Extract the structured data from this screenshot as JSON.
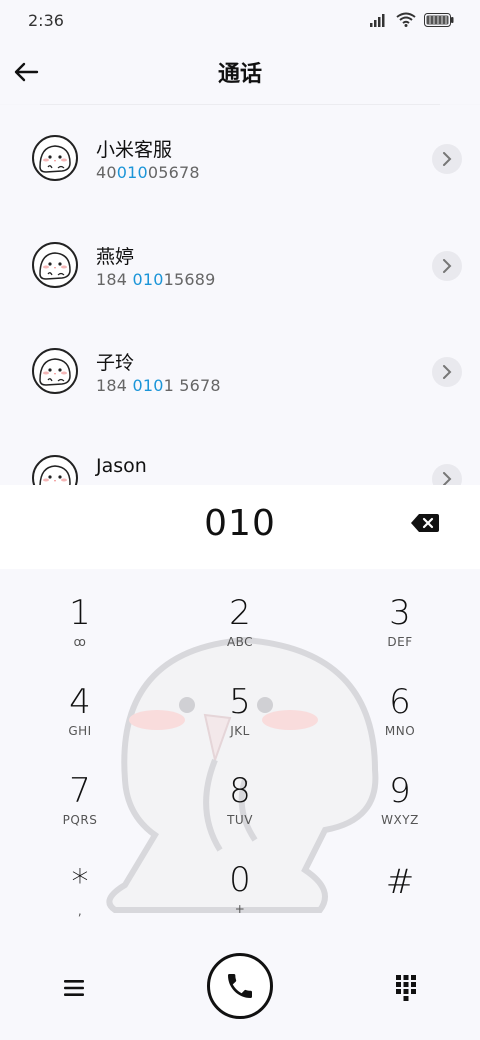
{
  "status_bar": {
    "time": "2:36"
  },
  "header": {
    "title": "通话"
  },
  "contacts": [
    {
      "name": "小米客服",
      "number_parts": [
        "40",
        "010",
        "05678"
      ]
    },
    {
      "name": "燕婷",
      "number_parts": [
        "184 ",
        "010",
        "15689"
      ]
    },
    {
      "name": "子玲",
      "number_parts": [
        "184 ",
        "010",
        "1 5678"
      ]
    },
    {
      "name": "Jason",
      "number_parts": [
        "",
        "",
        ""
      ]
    }
  ],
  "dialer": {
    "typed_number": "010",
    "keys": [
      {
        "digit": "1",
        "letters": "ꝏ"
      },
      {
        "digit": "2",
        "letters": "ABC"
      },
      {
        "digit": "3",
        "letters": "DEF"
      },
      {
        "digit": "4",
        "letters": "GHI"
      },
      {
        "digit": "5",
        "letters": "JKL"
      },
      {
        "digit": "6",
        "letters": "MNO"
      },
      {
        "digit": "7",
        "letters": "PQRS"
      },
      {
        "digit": "8",
        "letters": "TUV"
      },
      {
        "digit": "9",
        "letters": "WXYZ"
      },
      {
        "digit": "*",
        "letters": ","
      },
      {
        "digit": "0",
        "letters": "+"
      },
      {
        "digit": "#",
        "letters": ""
      }
    ]
  },
  "icons": {
    "back": "arrow-left-icon",
    "detail": "chevron-right-icon",
    "backspace": "backspace-icon",
    "menu": "hamburger-menu-icon",
    "call": "phone-icon",
    "keypad": "dialpad-icon",
    "signal": "signal-icon",
    "wifi": "wifi-icon",
    "battery": "battery-icon"
  },
  "colors": {
    "highlight": "#1b95d8",
    "background": "#f8f8fc"
  }
}
